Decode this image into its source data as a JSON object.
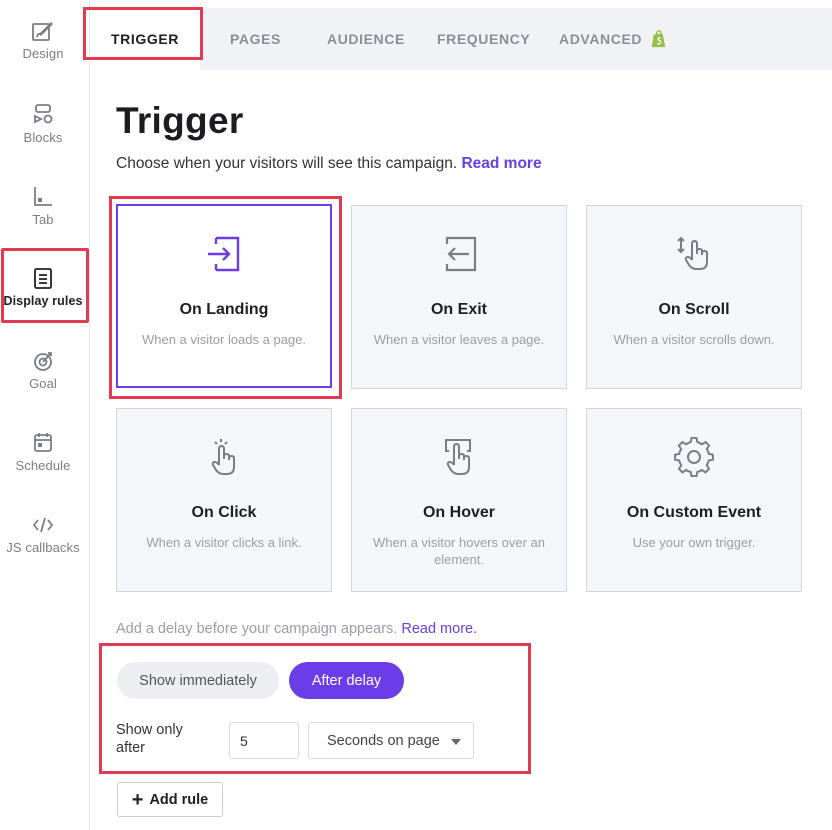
{
  "sidebar": {
    "items": [
      {
        "label": "Design",
        "icon": "brush-icon"
      },
      {
        "label": "Blocks",
        "icon": "blocks-icon"
      },
      {
        "label": "Tab",
        "icon": "tab-icon"
      },
      {
        "label": "Display rules",
        "icon": "document-icon",
        "active": true
      },
      {
        "label": "Goal",
        "icon": "target-icon"
      },
      {
        "label": "Schedule",
        "icon": "calendar-icon"
      },
      {
        "label": "JS callbacks",
        "icon": "code-icon"
      }
    ]
  },
  "tabs": [
    {
      "label": "TRIGGER",
      "active": true
    },
    {
      "label": "PAGES"
    },
    {
      "label": "AUDIENCE"
    },
    {
      "label": "FREQUENCY"
    },
    {
      "label": "ADVANCED"
    }
  ],
  "main": {
    "title": "Trigger",
    "subtitle": "Choose when your visitors will see this campaign.",
    "subtitle_link": "Read more"
  },
  "triggers": [
    {
      "title": "On Landing",
      "desc": "When a visitor loads a page.",
      "icon": "enter-icon",
      "selected": true
    },
    {
      "title": "On Exit",
      "desc": "When a visitor leaves a page.",
      "icon": "exit-icon"
    },
    {
      "title": "On Scroll",
      "desc": "When a visitor scrolls down.",
      "icon": "scroll-hand-icon"
    },
    {
      "title": "On Click",
      "desc": "When a visitor clicks a link.",
      "icon": "click-hand-icon"
    },
    {
      "title": "On Hover",
      "desc": "When a visitor hovers over an element.",
      "icon": "hover-hand-icon"
    },
    {
      "title": "On Custom Event",
      "desc": "Use your own trigger.",
      "icon": "gear-icon"
    }
  ],
  "delay": {
    "text": "Add a delay before your campaign appears.",
    "link": "Read more.",
    "option_immediately": "Show immediately",
    "option_delay": "After delay",
    "selected": "After delay",
    "show_only_after_label": "Show only after",
    "value": "5",
    "unit": "Seconds on page"
  },
  "actions": {
    "add_rule_label": "Add rule"
  },
  "colors": {
    "accent": "#6a3de8",
    "highlight": "#e23a50",
    "shopify": "#95bf47"
  }
}
